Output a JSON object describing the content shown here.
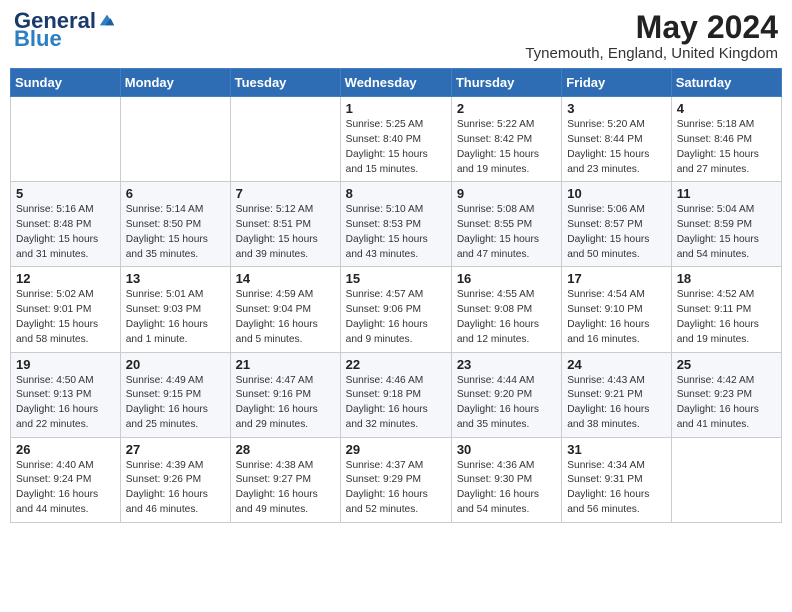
{
  "header": {
    "logo_general": "General",
    "logo_blue": "Blue",
    "month_title": "May 2024",
    "location": "Tynemouth, England, United Kingdom"
  },
  "weekdays": [
    "Sunday",
    "Monday",
    "Tuesday",
    "Wednesday",
    "Thursday",
    "Friday",
    "Saturday"
  ],
  "weeks": [
    [
      {
        "day": "",
        "info": ""
      },
      {
        "day": "",
        "info": ""
      },
      {
        "day": "",
        "info": ""
      },
      {
        "day": "1",
        "info": "Sunrise: 5:25 AM\nSunset: 8:40 PM\nDaylight: 15 hours and 15 minutes."
      },
      {
        "day": "2",
        "info": "Sunrise: 5:22 AM\nSunset: 8:42 PM\nDaylight: 15 hours and 19 minutes."
      },
      {
        "day": "3",
        "info": "Sunrise: 5:20 AM\nSunset: 8:44 PM\nDaylight: 15 hours and 23 minutes."
      },
      {
        "day": "4",
        "info": "Sunrise: 5:18 AM\nSunset: 8:46 PM\nDaylight: 15 hours and 27 minutes."
      }
    ],
    [
      {
        "day": "5",
        "info": "Sunrise: 5:16 AM\nSunset: 8:48 PM\nDaylight: 15 hours and 31 minutes."
      },
      {
        "day": "6",
        "info": "Sunrise: 5:14 AM\nSunset: 8:50 PM\nDaylight: 15 hours and 35 minutes."
      },
      {
        "day": "7",
        "info": "Sunrise: 5:12 AM\nSunset: 8:51 PM\nDaylight: 15 hours and 39 minutes."
      },
      {
        "day": "8",
        "info": "Sunrise: 5:10 AM\nSunset: 8:53 PM\nDaylight: 15 hours and 43 minutes."
      },
      {
        "day": "9",
        "info": "Sunrise: 5:08 AM\nSunset: 8:55 PM\nDaylight: 15 hours and 47 minutes."
      },
      {
        "day": "10",
        "info": "Sunrise: 5:06 AM\nSunset: 8:57 PM\nDaylight: 15 hours and 50 minutes."
      },
      {
        "day": "11",
        "info": "Sunrise: 5:04 AM\nSunset: 8:59 PM\nDaylight: 15 hours and 54 minutes."
      }
    ],
    [
      {
        "day": "12",
        "info": "Sunrise: 5:02 AM\nSunset: 9:01 PM\nDaylight: 15 hours and 58 minutes."
      },
      {
        "day": "13",
        "info": "Sunrise: 5:01 AM\nSunset: 9:03 PM\nDaylight: 16 hours and 1 minute."
      },
      {
        "day": "14",
        "info": "Sunrise: 4:59 AM\nSunset: 9:04 PM\nDaylight: 16 hours and 5 minutes."
      },
      {
        "day": "15",
        "info": "Sunrise: 4:57 AM\nSunset: 9:06 PM\nDaylight: 16 hours and 9 minutes."
      },
      {
        "day": "16",
        "info": "Sunrise: 4:55 AM\nSunset: 9:08 PM\nDaylight: 16 hours and 12 minutes."
      },
      {
        "day": "17",
        "info": "Sunrise: 4:54 AM\nSunset: 9:10 PM\nDaylight: 16 hours and 16 minutes."
      },
      {
        "day": "18",
        "info": "Sunrise: 4:52 AM\nSunset: 9:11 PM\nDaylight: 16 hours and 19 minutes."
      }
    ],
    [
      {
        "day": "19",
        "info": "Sunrise: 4:50 AM\nSunset: 9:13 PM\nDaylight: 16 hours and 22 minutes."
      },
      {
        "day": "20",
        "info": "Sunrise: 4:49 AM\nSunset: 9:15 PM\nDaylight: 16 hours and 25 minutes."
      },
      {
        "day": "21",
        "info": "Sunrise: 4:47 AM\nSunset: 9:16 PM\nDaylight: 16 hours and 29 minutes."
      },
      {
        "day": "22",
        "info": "Sunrise: 4:46 AM\nSunset: 9:18 PM\nDaylight: 16 hours and 32 minutes."
      },
      {
        "day": "23",
        "info": "Sunrise: 4:44 AM\nSunset: 9:20 PM\nDaylight: 16 hours and 35 minutes."
      },
      {
        "day": "24",
        "info": "Sunrise: 4:43 AM\nSunset: 9:21 PM\nDaylight: 16 hours and 38 minutes."
      },
      {
        "day": "25",
        "info": "Sunrise: 4:42 AM\nSunset: 9:23 PM\nDaylight: 16 hours and 41 minutes."
      }
    ],
    [
      {
        "day": "26",
        "info": "Sunrise: 4:40 AM\nSunset: 9:24 PM\nDaylight: 16 hours and 44 minutes."
      },
      {
        "day": "27",
        "info": "Sunrise: 4:39 AM\nSunset: 9:26 PM\nDaylight: 16 hours and 46 minutes."
      },
      {
        "day": "28",
        "info": "Sunrise: 4:38 AM\nSunset: 9:27 PM\nDaylight: 16 hours and 49 minutes."
      },
      {
        "day": "29",
        "info": "Sunrise: 4:37 AM\nSunset: 9:29 PM\nDaylight: 16 hours and 52 minutes."
      },
      {
        "day": "30",
        "info": "Sunrise: 4:36 AM\nSunset: 9:30 PM\nDaylight: 16 hours and 54 minutes."
      },
      {
        "day": "31",
        "info": "Sunrise: 4:34 AM\nSunset: 9:31 PM\nDaylight: 16 hours and 56 minutes."
      },
      {
        "day": "",
        "info": ""
      }
    ]
  ]
}
